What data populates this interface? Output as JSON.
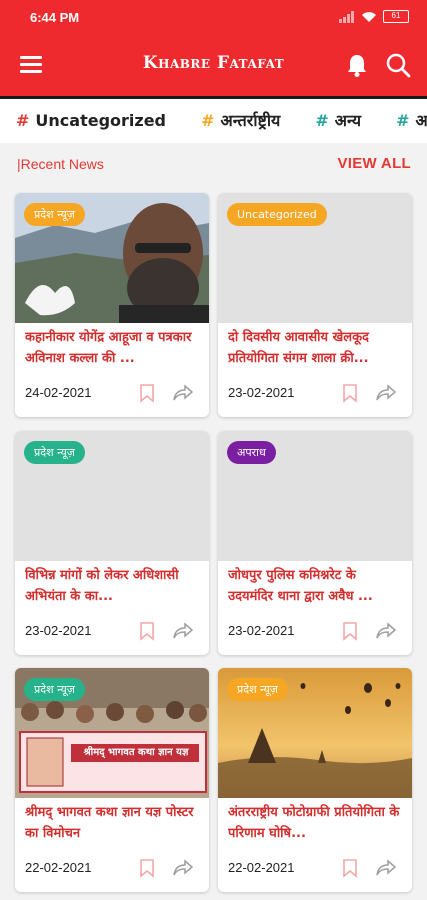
{
  "status": {
    "time": "6:44 PM",
    "battery": "61"
  },
  "app": {
    "title": "Khabre Fatafat"
  },
  "categories": [
    {
      "label": "Uncategorized",
      "hash_color": "#e53935"
    },
    {
      "label": "अन्तर्राष्ट्रीय",
      "hash_color": "#f9a825"
    },
    {
      "label": "अन्य",
      "hash_color": "#26a69a"
    },
    {
      "label": "अन्य",
      "hash_color": "#26a69a"
    }
  ],
  "section": {
    "title": "|Recent News",
    "view_all": "VIEW ALL"
  },
  "cards": [
    {
      "badge": "प्रदेश न्यूज़",
      "badge_color": "#f5a623",
      "headline": "कहानीकार योगेंद्र आहूजा व पत्रकार अविनाश कल्ला की ...",
      "date": "24-02-2021",
      "image": "portrait"
    },
    {
      "badge": "Uncategorized",
      "badge_color": "#f5a623",
      "headline": "दो दिवसीय आवासीय खेलकूद प्रतियोगिता संगम शाला क्री...",
      "date": "23-02-2021",
      "image": "blank"
    },
    {
      "badge": "प्रदेश न्यूज़",
      "badge_color": "#26b28a",
      "headline": "विभिन्न मांगों को लेकर अधिशासी अभियंता के का...",
      "date": "23-02-2021",
      "image": "blank"
    },
    {
      "badge": "अपराध",
      "badge_color": "#7b1fa2",
      "headline": "जोधपुर पुलिस कमिश्नरेट के उदयमंदिर थाना द्वारा अवैध ...",
      "date": "23-02-2021",
      "image": "blank"
    },
    {
      "badge": "प्रदेश न्यूज़",
      "badge_color": "#26b28a",
      "headline": "श्रीमद् भागवत कथा ज्ञान यज्ञ पोस्टर का विमोचन",
      "date": "22-02-2021",
      "image": "poster",
      "banner_text": "श्रीमद् भागवत कथा ज्ञान यज्ञ"
    },
    {
      "badge": "प्रदेश न्यूज़",
      "badge_color": "#f5a623",
      "headline": "अंतरराष्ट्रीय फोटोग्राफी प्रतियोगिता के परिणाम घोषि...",
      "date": "22-02-2021",
      "image": "landscape"
    }
  ],
  "colors": {
    "primary": "#ee2a2f",
    "accent_text": "#d32f2f"
  },
  "icons": {
    "menu": "hamburger-icon",
    "bell": "bell-icon",
    "search": "search-icon",
    "bookmark": "bookmark-icon",
    "share": "share-icon"
  }
}
